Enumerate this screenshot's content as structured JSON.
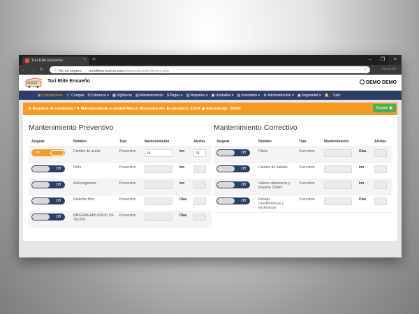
{
  "browser": {
    "tab_title": "Turi Elite Ensueño",
    "tab_close": "×",
    "new_tab": "+",
    "win_min": "–",
    "win_max": "❐",
    "win_close": "×",
    "security": "No es seguro",
    "domain": "turieliteensueno.com",
    "path": "/sistema/control/index.php",
    "incognito": "Incognito"
  },
  "app": {
    "brand": "Turi Elite Ensueño",
    "user": "DEMO DEMO"
  },
  "menu": [
    {
      "icon": "▣",
      "label": "Cotizaciones"
    },
    {
      "icon": "🛒",
      "label": "Compra"
    },
    {
      "icon": "$",
      "label": "Cobranza ▾"
    },
    {
      "icon": "▦",
      "label": "Vigilancia"
    },
    {
      "icon": "▤",
      "label": "Mantenimiento"
    },
    {
      "icon": "$",
      "label": "Pagos ▾"
    },
    {
      "icon": "▥",
      "label": "Reportes ▾"
    },
    {
      "icon": "▣",
      "label": "Unidades ▾"
    },
    {
      "icon": "▤",
      "label": "Inventario ▾"
    },
    {
      "icon": "⚙",
      "label": "Administración ▾"
    },
    {
      "icon": "▣",
      "label": "Seguridad ▾"
    },
    {
      "icon": "🔔",
      "label": ""
    },
    {
      "icon": "",
      "label": "Salir"
    }
  ],
  "alert": {
    "text1": "Registro de camiones /",
    "text2": "Mantenimiento a unidad Marca :Mercedes No. Economico: XXXX",
    "text3": "Kilometraje: 25000",
    "accept": "Aceptar"
  },
  "preventivo": {
    "title": "Mantenimiento Preventivo",
    "headers": [
      "Asignar",
      "Nombre",
      "Tipo",
      "Mantenimiento",
      "",
      "Alertas"
    ],
    "rows": [
      {
        "toggle": "On",
        "on": true,
        "name": "Cambio de aceite",
        "type": "Preventivo",
        "value": "44",
        "unit": "km",
        "alert": "33"
      },
      {
        "toggle": "Off",
        "on": false,
        "name": "Filtro",
        "type": "Preventivo",
        "value": "",
        "unit": "km",
        "alert": ""
      },
      {
        "toggle": "Off",
        "on": false,
        "name": "Anticongelante",
        "type": "Preventivo",
        "value": "",
        "unit": "km",
        "alert": ""
      },
      {
        "toggle": "Off",
        "on": false,
        "name": "Retardar filtro",
        "type": "Preventivo",
        "value": "",
        "unit": "Dias",
        "alert": ""
      },
      {
        "toggle": "Off",
        "on": false,
        "name": "IMPERMEABILIZADO DE TECHO",
        "type": "Preventivo",
        "value": "",
        "unit": "Dias",
        "alert": ""
      }
    ]
  },
  "correctivo": {
    "title": "Mantenimiento Correctivo",
    "headers": [
      "Asignar",
      "Nombre",
      "Tipo",
      "Mantenimiento",
      "",
      "Alertas"
    ],
    "rows": [
      {
        "toggle": "Off",
        "on": false,
        "name": "Clima",
        "type": "Correctivo",
        "value": "",
        "unit": "Dias",
        "alert": ""
      },
      {
        "toggle": "Off",
        "on": false,
        "name": "Cambio de balatas",
        "type": "Correctivo",
        "value": "",
        "unit": "km",
        "alert": ""
      },
      {
        "toggle": "Off",
        "on": false,
        "name": "Valeros delanteros y traseros 100km",
        "type": "Correctivo",
        "value": "",
        "unit": "km",
        "alert": ""
      },
      {
        "toggle": "Off",
        "on": false,
        "name": "Rotulas concÃ©ntricas y excéntricos",
        "type": "Correctivo",
        "value": "",
        "unit": "Dias",
        "alert": ""
      }
    ]
  }
}
